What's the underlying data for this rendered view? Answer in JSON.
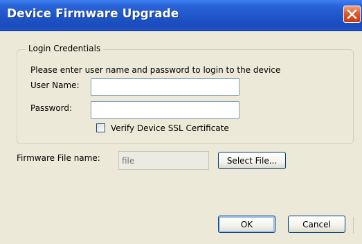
{
  "window": {
    "title": "Device Firmware Upgrade"
  },
  "login_group": {
    "legend": "Login Credentials",
    "instruction": "Please enter user name and password to login to the device",
    "username_label": "User Name:",
    "username_value": "",
    "password_label": "Password:",
    "password_value": "",
    "verify_ssl_label": "Verify Device SSL Certificate",
    "verify_ssl_checked": false
  },
  "firmware": {
    "label": "Firmware File name:",
    "file_placeholder": "file",
    "select_button": "Select File..."
  },
  "buttons": {
    "ok": "OK",
    "cancel": "Cancel"
  },
  "colors": {
    "titlebar": "#1f55c8",
    "dialog_bg": "#ece9d8",
    "close_button": "#e0592a"
  }
}
